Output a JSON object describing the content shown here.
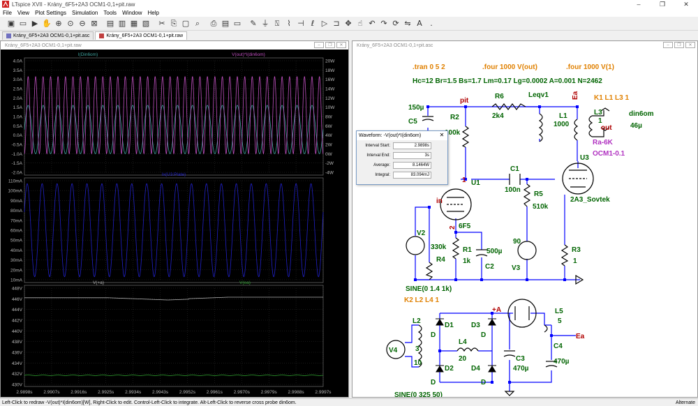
{
  "window": {
    "title": "LTspice XVII - Krány_6F5+2A3 OCM1-0,1+pit.raw"
  },
  "menu": [
    "File",
    "View",
    "Plot Settings",
    "Simulation",
    "Tools",
    "Window",
    "Help"
  ],
  "tabs": [
    {
      "label": "Krány_6F5+2A3 OCM1-0,1+pit.asc",
      "active": false
    },
    {
      "label": "Krány_6F5+2A3 OCM1-0,1+pit.raw",
      "active": true
    }
  ],
  "waveform_window": {
    "title": "Krány_6F5+2A3 OCM1-0,1+pit.raw",
    "pane1": {
      "trace1": "I(Din6om)",
      "trace2": "V(out)*I(din6om)",
      "yleft": [
        "4.0A",
        "3.5A",
        "3.0A",
        "2.5A",
        "2.0A",
        "1.5A",
        "1.0A",
        "0.5A",
        "0.0A",
        "-0.5A",
        "-1.0A",
        "-1.5A",
        "-2.0A"
      ],
      "yright": [
        "20W",
        "18W",
        "16W",
        "14W",
        "12W",
        "10W",
        "8W",
        "6W",
        "4W",
        "2W",
        "0W",
        "-2W",
        "-4W"
      ],
      "current_range": [
        -2.0,
        4.0
      ],
      "power_range": [
        -4,
        20
      ],
      "trace1_color": "#3fa5a0",
      "trace2_color": "#c050c0"
    },
    "pane2": {
      "trace1": "Ix(U3:Plate)",
      "yleft": [
        "110mA",
        "100mA",
        "90mA",
        "80mA",
        "70mA",
        "60mA",
        "50mA",
        "40mA",
        "30mA",
        "20mA",
        "10mA"
      ],
      "range": [
        10,
        110
      ],
      "trace1_color": "#2020c8"
    },
    "pane3": {
      "trace1": "V(+a)",
      "trace2": "V(ea)",
      "yleft": [
        "448V",
        "446V",
        "444V",
        "442V",
        "440V",
        "438V",
        "436V",
        "434V",
        "432V",
        "430V"
      ],
      "range": [
        430,
        448
      ],
      "trace1_color": "#b0b0b0",
      "trace2_color": "#30a030"
    },
    "xaxis": [
      "2.9898s",
      "2.9907s",
      "2.9916s",
      "2.9925s",
      "2.9934s",
      "2.9943s",
      "2.9952s",
      "2.9961s",
      "2.9970s",
      "2.9979s",
      "2.9988s",
      "2.9997s"
    ]
  },
  "schematic_window": {
    "title": "Krány_6F5+2A3 OCM1-0,1+pit.asc"
  },
  "schematic": {
    "directives": [
      ".tran 0 5 2",
      ".four 1000 V(out)",
      ".four 1000 V(1)"
    ],
    "core_params": "Hc=12 Br=1.5 Bs=1.7 Lm=0.17 Lg=0.0002 A=0.001 N=2462",
    "coupling": "K1 L1 L3 1",
    "labels": {
      "pit": "pit",
      "c5": "C5",
      "c5_val": "150µ",
      "r6": "R6",
      "r6_val": "2k4",
      "leqv": "Leqv1",
      "l1": "L1",
      "l1_val": "1000",
      "l3": "L3",
      "l3_val": "1",
      "l3_val2": "46µ",
      "out": "out",
      "din6om": "din6om",
      "r2": "R2",
      "r2_val": "100k",
      "ea_top": "Ea",
      "ra": "Ra-6K",
      "ocm": "OCM1-0.1",
      "u3": "U3",
      "c1": "C1",
      "c1_val": "100n",
      "u1": "U1",
      "node1": "1",
      "in": "in",
      "r5": "R5",
      "r5_val": "510k",
      "tube2": "2A3_Sovtek",
      "v2": "V2",
      "r4": "R4",
      "r4_val": "330k",
      "node2": "2",
      "tube1": "6F5",
      "r1": "R1",
      "r1_val": "1k",
      "c2": "C2",
      "c2_val": "500µ",
      "v3": "V3",
      "v3_val": "90",
      "r3": "R3",
      "r3_val": "1",
      "sine1": "SINE(0 1.4 1k)",
      "coupling2": "K2 L2 L4 1",
      "plus_a": "+A",
      "l5": "L5",
      "l5_val": "5",
      "l2": "L2",
      "l2_val": "3",
      "l2_val2": "10",
      "v4": "V4",
      "d1": "D1",
      "d3": "D3",
      "d2": "D2",
      "d4": "D4",
      "l4": "L4",
      "l4_val": "20",
      "c3": "C3",
      "c3_val": "470µ",
      "c4": "C4",
      "c4_val": "470µ",
      "ea_bottom": "Ea",
      "sine2": "SINE(0 325 50)",
      "d": "D"
    }
  },
  "waveform_popup": {
    "title": "Waveform: -V(out)*I(din6om)",
    "interval_start_label": "Interval Start:",
    "interval_start": "2.9898s",
    "interval_end_label": "Interval End:",
    "interval_end": "3s",
    "average_label": "Average:",
    "average": "8.1464W",
    "integral_label": "Integral:",
    "integral": "83.094mJ"
  },
  "status": {
    "left": "Left-Click to redraw -V(out)*I(din6om)[W],  Right-Click to edit. Control-Left-Click to integrate. Alt-Left-Click to reverse cross probe din6om.",
    "right": "Alternate"
  },
  "colors": {
    "schematic_wire": "#0000ff",
    "label_green": "#006400",
    "label_orange": "#e08000",
    "label_purple": "#b030c0",
    "label_red": "#b00000",
    "plot_bg": "#000000"
  }
}
